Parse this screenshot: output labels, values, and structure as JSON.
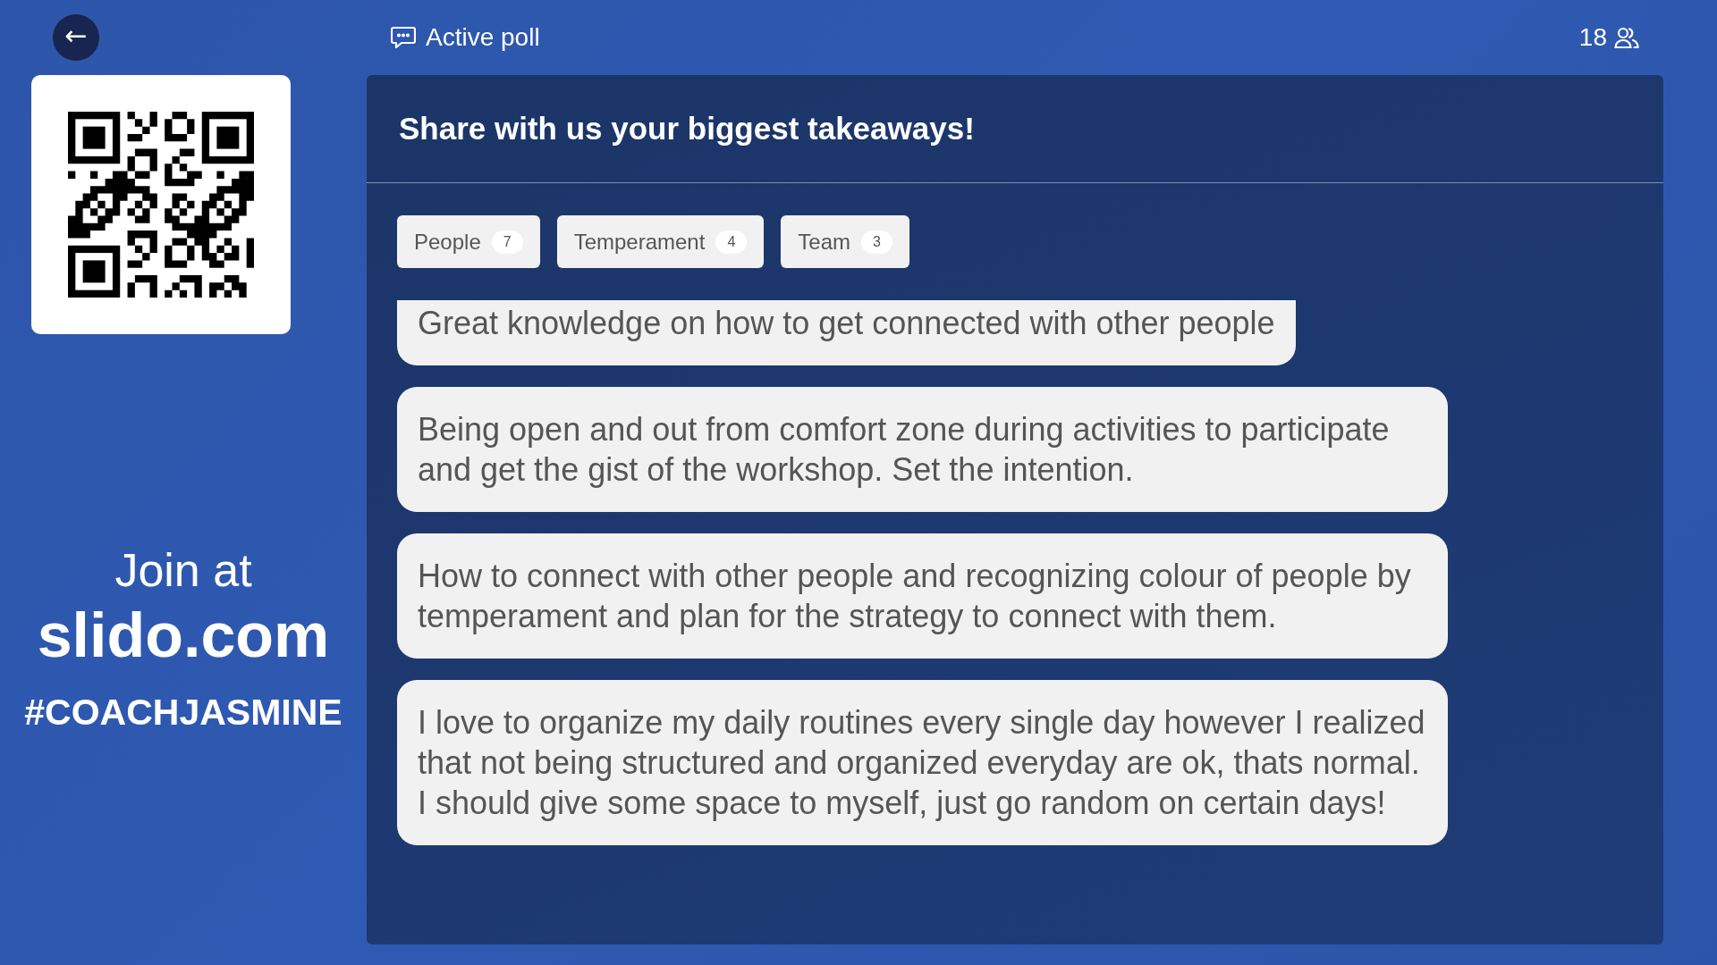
{
  "top_bar": {
    "back_button": "←",
    "title": "Active poll",
    "participants": "18"
  },
  "join": {
    "prompt": "Join at",
    "site": "slido.com",
    "code": "#COACHJASMINE"
  },
  "poll": {
    "question": "Share with us your biggest takeaways!",
    "tags": [
      {
        "label": "People",
        "count": "7"
      },
      {
        "label": "Temperament",
        "count": "4"
      },
      {
        "label": "Team",
        "count": "3"
      }
    ],
    "answers": [
      "Great knowledge on how to get connected with other people",
      "Being open and out from comfort zone during activities to participate and get the gist of the workshop. Set the intention.",
      "How to connect with other people and recognizing colour of people by temperament and plan for the strategy to connect with them.",
      "I love to organize my daily routines every single day however I realized that not being structured and organized everyday are ok, thats normal. I should give some space to myself, just go random on certain days!"
    ]
  }
}
